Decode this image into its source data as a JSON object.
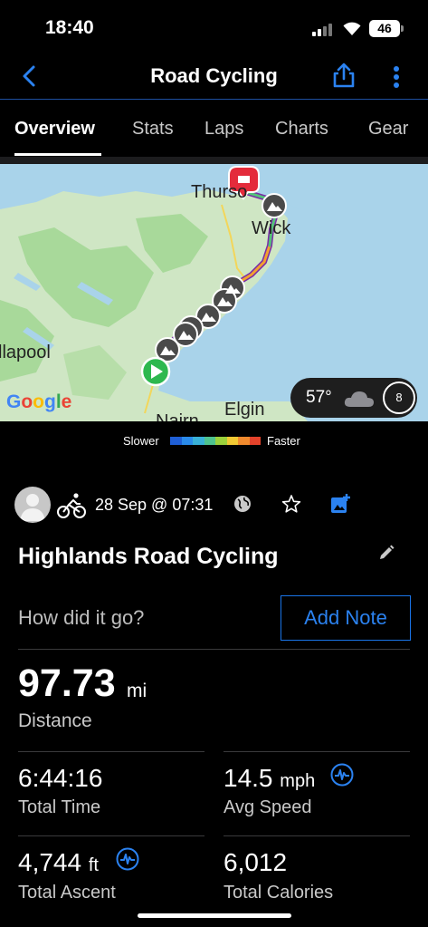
{
  "status_bar": {
    "time": "18:40",
    "battery": "46"
  },
  "nav": {
    "title": "Road Cycling"
  },
  "tabs": [
    {
      "label": "Overview",
      "active": true
    },
    {
      "label": "Stats"
    },
    {
      "label": "Laps"
    },
    {
      "label": "Charts"
    },
    {
      "label": "Gear"
    }
  ],
  "map": {
    "places": [
      "Thurso",
      "Wick",
      "llapool",
      "Elgin",
      "Nairn"
    ],
    "attribution": "Google",
    "weather": {
      "temp": "57°",
      "wind": "8"
    }
  },
  "legend": {
    "slower": "Slower",
    "faster": "Faster",
    "colors": [
      "#1f5fd6",
      "#2a8bea",
      "#39b1d8",
      "#4ec38f",
      "#9bd13c",
      "#f1c933",
      "#f08a2e",
      "#e4432b"
    ]
  },
  "activity": {
    "date": "28 Sep @ 07:31",
    "name": "Highlands Road Cycling",
    "prompt": "How did it go?",
    "add_note": "Add Note"
  },
  "distance": {
    "value": "97.73",
    "unit": "mi",
    "label": "Distance"
  },
  "stats": {
    "total_time": {
      "value": "6:44:16",
      "label": "Total Time"
    },
    "avg_speed": {
      "value": "14.5",
      "unit": "mph",
      "label": "Avg Speed"
    },
    "total_ascent": {
      "value": "4,744",
      "unit": "ft",
      "label": "Total Ascent"
    },
    "total_calories": {
      "value": "6,012",
      "label": "Total Calories"
    }
  },
  "colors": {
    "accent": "#2b82f0",
    "background": "#000000"
  }
}
